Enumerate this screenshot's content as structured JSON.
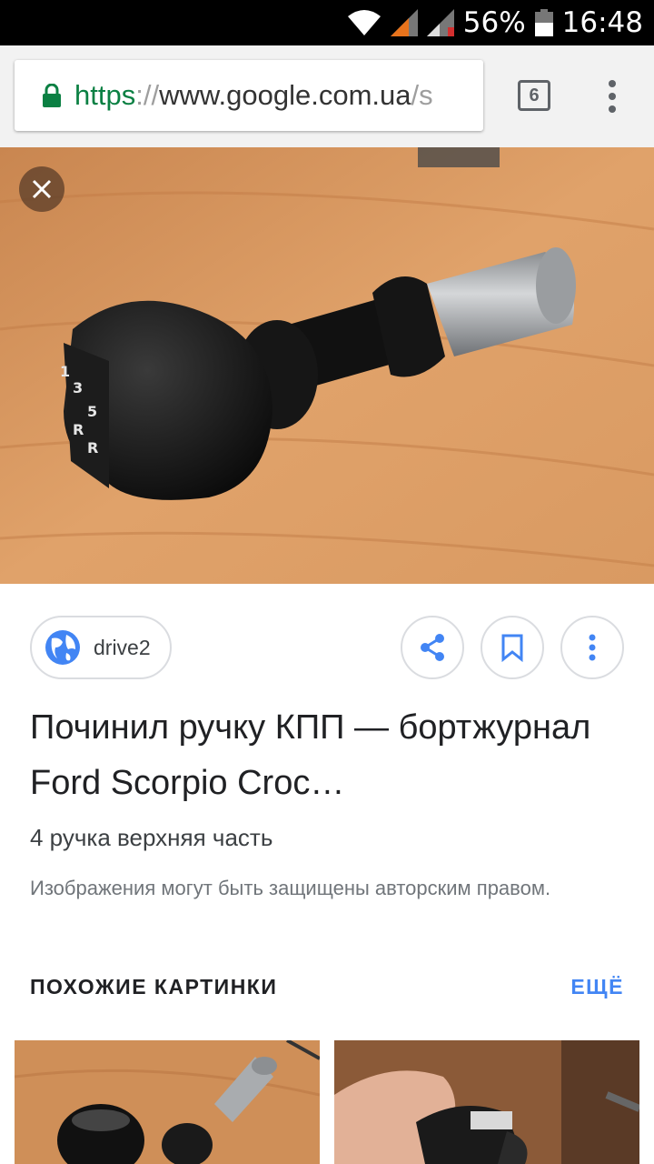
{
  "status_bar": {
    "battery": "56%",
    "time": "16:48",
    "icons": [
      "wifi-icon",
      "signal-icon",
      "signal-no-data-icon",
      "battery-icon"
    ]
  },
  "browser": {
    "url_scheme": "https",
    "url_separator": "://",
    "url_host": "www.google.com.ua",
    "url_rest": "/s",
    "tab_count": "6"
  },
  "result": {
    "source": "drive2",
    "title": "Починил ручку КПП — бортжурнал Ford Scorpio Croc…",
    "subtitle": "4 ручка верхняя часть",
    "copyright": "Изображения могут быть защищены авторским правом."
  },
  "similar": {
    "heading": "ПОХОЖИЕ КАРТИНКИ",
    "more": "ЕЩЁ"
  },
  "colors": {
    "accent": "#4285f4",
    "secure_green": "#0b8043",
    "wood": "#d7935a"
  }
}
